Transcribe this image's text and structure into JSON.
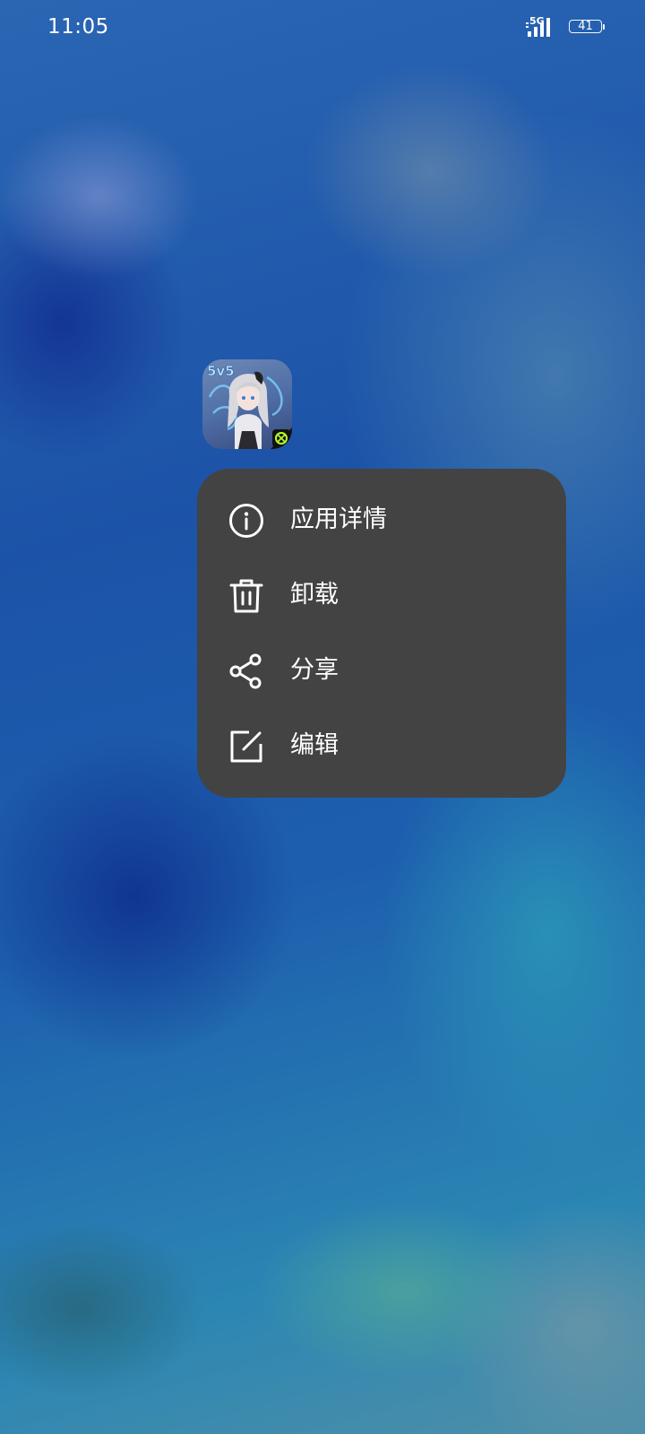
{
  "status_bar": {
    "time": "11:05",
    "network": "5G",
    "battery": "41"
  },
  "app": {
    "icon_badge_text": "5v5",
    "icon_name": "game-app-icon"
  },
  "context_menu": {
    "items": [
      {
        "label": "应用详情",
        "icon": "info-icon"
      },
      {
        "label": "卸载",
        "icon": "trash-icon"
      },
      {
        "label": "分享",
        "icon": "share-icon"
      },
      {
        "label": "编辑",
        "icon": "edit-icon"
      }
    ]
  },
  "colors": {
    "menu_background": "#434343",
    "text": "#ffffff"
  }
}
